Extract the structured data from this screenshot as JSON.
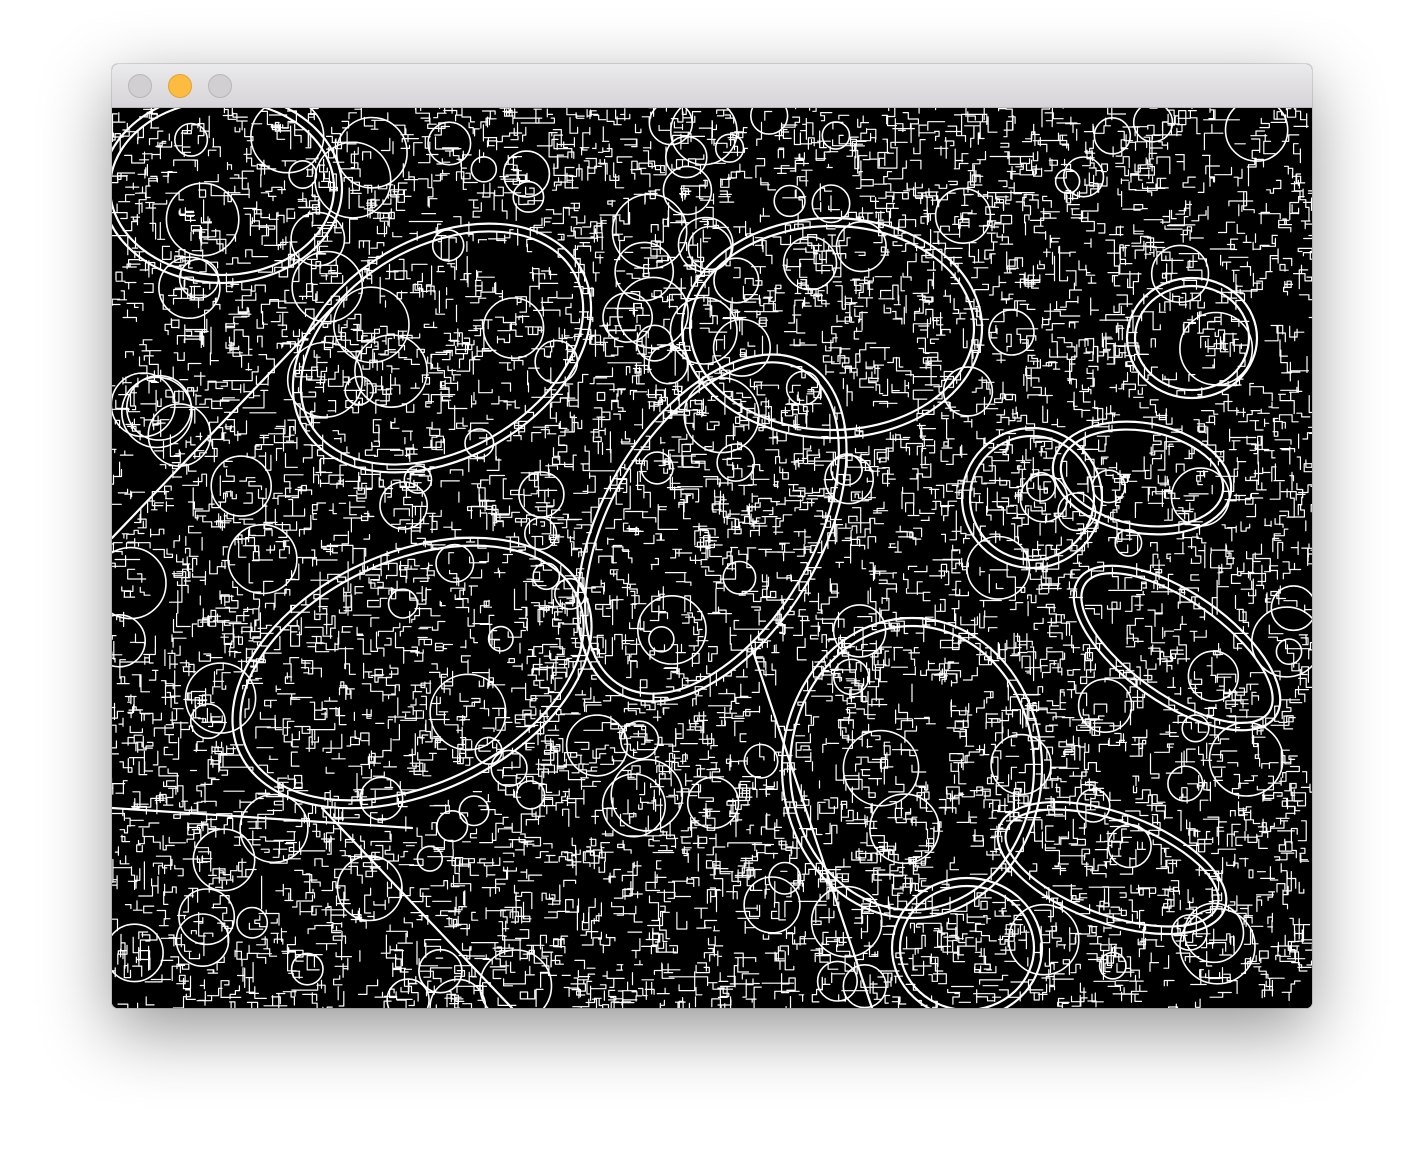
{
  "window": {
    "title": "",
    "controls": {
      "close": "close-icon",
      "minimize": "minimize-icon",
      "zoom": "zoom-icon"
    },
    "colors": {
      "titlebar": "#dedcdf",
      "minimize_active": "#fdbc40",
      "inactive_button": "#d1cfd2"
    }
  },
  "image": {
    "kind": "edge-detection output",
    "background": "#000000",
    "stroke": "#ffffff"
  }
}
